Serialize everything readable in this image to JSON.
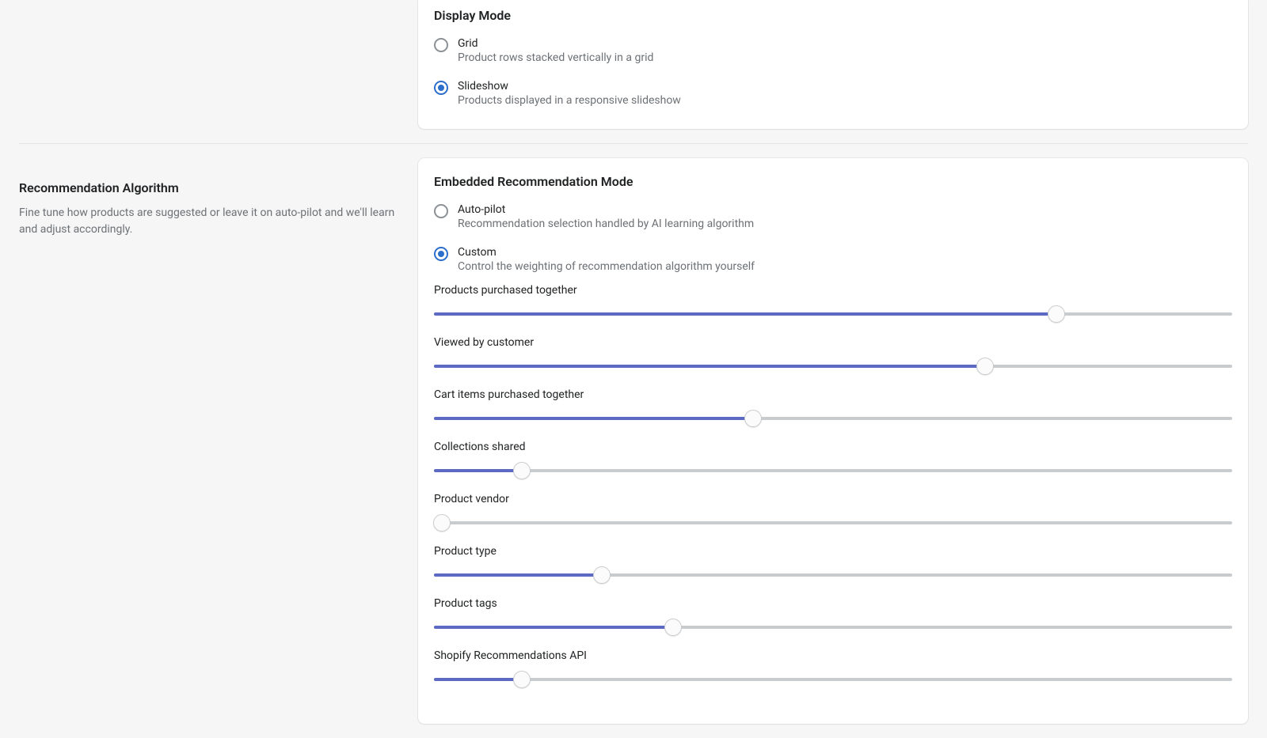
{
  "displayMode": {
    "heading": "Display Mode",
    "options": [
      {
        "label": "Grid",
        "desc": "Product rows stacked vertically in a grid",
        "selected": false
      },
      {
        "label": "Slideshow",
        "desc": "Products displayed in a responsive slideshow",
        "selected": true
      }
    ]
  },
  "algoSection": {
    "heading": "Recommendation Algorithm",
    "desc": "Fine tune how products are suggested or leave it on auto-pilot and we'll learn and adjust accordingly."
  },
  "embeddedMode": {
    "heading": "Embedded Recommendation Mode",
    "options": [
      {
        "label": "Auto-pilot",
        "desc": "Recommendation selection handled by AI learning algorithm",
        "selected": false
      },
      {
        "label": "Custom",
        "desc": "Control the weighting of recommendation algorithm yourself",
        "selected": true
      }
    ],
    "sliders": [
      {
        "label": "Products purchased together",
        "value": 78
      },
      {
        "label": "Viewed by customer",
        "value": 69
      },
      {
        "label": "Cart items purchased together",
        "value": 40
      },
      {
        "label": "Collections shared",
        "value": 11
      },
      {
        "label": "Product vendor",
        "value": 1
      },
      {
        "label": "Product type",
        "value": 21
      },
      {
        "label": "Product tags",
        "value": 30
      },
      {
        "label": "Shopify Recommendations API",
        "value": 11
      }
    ]
  }
}
